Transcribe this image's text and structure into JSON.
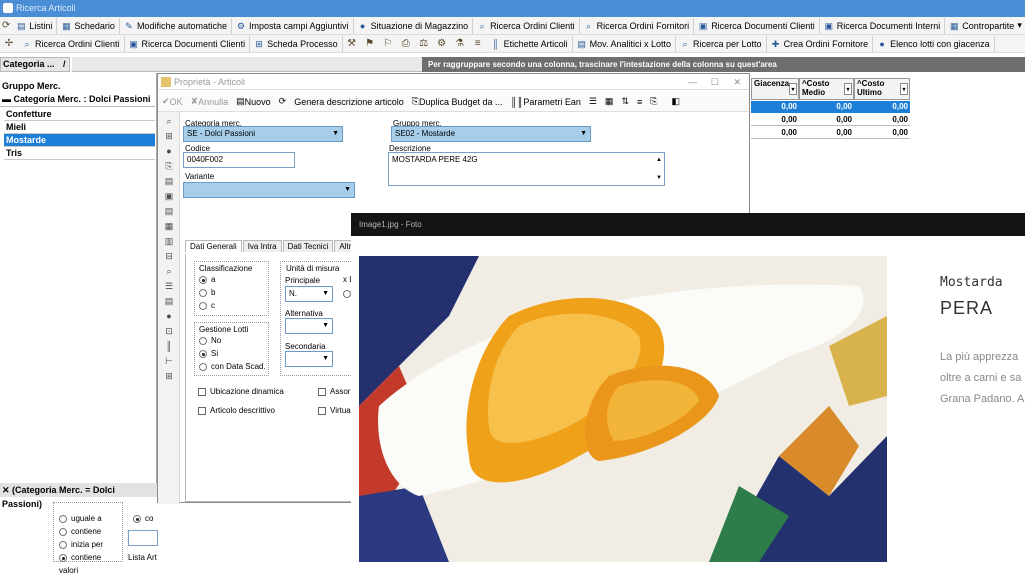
{
  "window": {
    "title": "Ricerca Articoli"
  },
  "toolbar1": [
    {
      "label": "Listini",
      "icon": "list-icon"
    },
    {
      "label": "Schedario",
      "icon": "folder-icon"
    },
    {
      "label": "Modifiche automatiche",
      "icon": "edit-icon"
    },
    {
      "label": "Imposta campi Aggiuntivi",
      "icon": "fields-icon"
    },
    {
      "label": "Situazione di Magazzino",
      "icon": "warehouse-icon"
    },
    {
      "label": "Ricerca Ordini Clienti",
      "icon": "search-icon"
    },
    {
      "label": "Ricerca Ordini Fornitori",
      "icon": "search-icon"
    },
    {
      "label": "Ricerca Documenti Clienti",
      "icon": "doc-search-icon"
    },
    {
      "label": "Ricerca Documenti Interni",
      "icon": "doc-search-icon"
    },
    {
      "label": "Contropartite",
      "icon": "grid-icon"
    }
  ],
  "toolbar2": [
    {
      "label": "Ricerca Ordini Clienti",
      "icon": "search-icon"
    },
    {
      "label": "Ricerca Documenti Clienti",
      "icon": "doc-search-icon"
    },
    {
      "label": "Scheda Processo",
      "icon": "process-icon"
    },
    {
      "label": "Etichette Articoli",
      "icon": "barcode-icon"
    },
    {
      "label": "Mov. Analitici x Lotto",
      "icon": "table-icon"
    },
    {
      "label": "Ricerca per Lotto",
      "icon": "search-icon"
    },
    {
      "label": "Crea Ordini Fornitore",
      "icon": "create-icon"
    },
    {
      "label": "Elenco lotti con giacenza",
      "icon": "list-icon"
    }
  ],
  "left": {
    "tab_label": "Categoria ...",
    "tab_close": "/",
    "group_header": "Gruppo Merc.",
    "group_row": "Categoria Merc. : Dolci Passioni",
    "rows": [
      "Confetture",
      "Mieli",
      "Mostarde",
      "Tris"
    ],
    "selected_row": "Mostarde",
    "filter_text": "(Categoria Merc. = Dolci Passioni)",
    "filter_options": [
      "uguale a",
      "contiene",
      "inizia per",
      "contiene valori"
    ],
    "filter_selected": "contiene valori",
    "filter_side_label": "co",
    "lista_label": "Lista Art"
  },
  "right": {
    "group_hint": "Per raggruppare secondo una colonna, trascinare l'intestazione della colonna su quest'area",
    "columns": [
      "Giacenza",
      "^Costo Medio",
      "^Costo Ultimo"
    ],
    "rows": [
      [
        "0,00",
        "0,00",
        "0,00"
      ],
      [
        "0,00",
        "0,00",
        "0,00"
      ],
      [
        "0,00",
        "0,00",
        "0,00"
      ]
    ]
  },
  "dialog": {
    "title": "Proprietà - Articoli",
    "toolbar": {
      "ok": "OK",
      "cancel": "Annulla",
      "new": "Nuovo",
      "gen_desc": "Genera descrizione articolo",
      "dup_budget": "Duplica Budget da ...",
      "ean": "Parametri Ean"
    },
    "fields": {
      "categoria_label": "Categoria merc.",
      "categoria_value": "SE - Dolci Passioni",
      "gruppo_label": "Gruppo merc.",
      "gruppo_value": "SE02 - Mostarde",
      "codice_label": "Codice",
      "codice_value": "0040F002",
      "descrizione_label": "Descrizione",
      "descrizione_value": "MOSTARDA PERE 42G",
      "variante_label": "Variante",
      "variante_value": ""
    },
    "tabs": [
      "Dati Generali",
      "Iva Intra",
      "Dati Tecnici",
      "Altre Info"
    ],
    "active_tab": "Dati Generali",
    "classificazione": {
      "label": "Classificazione",
      "options": [
        "a",
        "b",
        "c"
      ],
      "selected": "a"
    },
    "lotti": {
      "label": "Gestione Lotti",
      "options": [
        "No",
        "Si",
        "con Data Scad."
      ],
      "selected": "Si"
    },
    "um": {
      "label": "Unità di misura",
      "principale_label": "Principale",
      "principale_value": "N.",
      "alternativa_label": "Alternativa",
      "secondaria_label": "Secondaria",
      "x_label": "x L"
    },
    "checks": [
      "Ubicazione dinamica",
      "Articolo descrittivo",
      "Assor",
      "Virtual"
    ]
  },
  "photo": {
    "title": "Image1.jpg - Foto",
    "heading_small": "Mostarda",
    "heading_big": "PERA",
    "text_lines": [
      "La più apprezza",
      "oltre a carni e sa",
      "Grana Padano. A"
    ]
  }
}
